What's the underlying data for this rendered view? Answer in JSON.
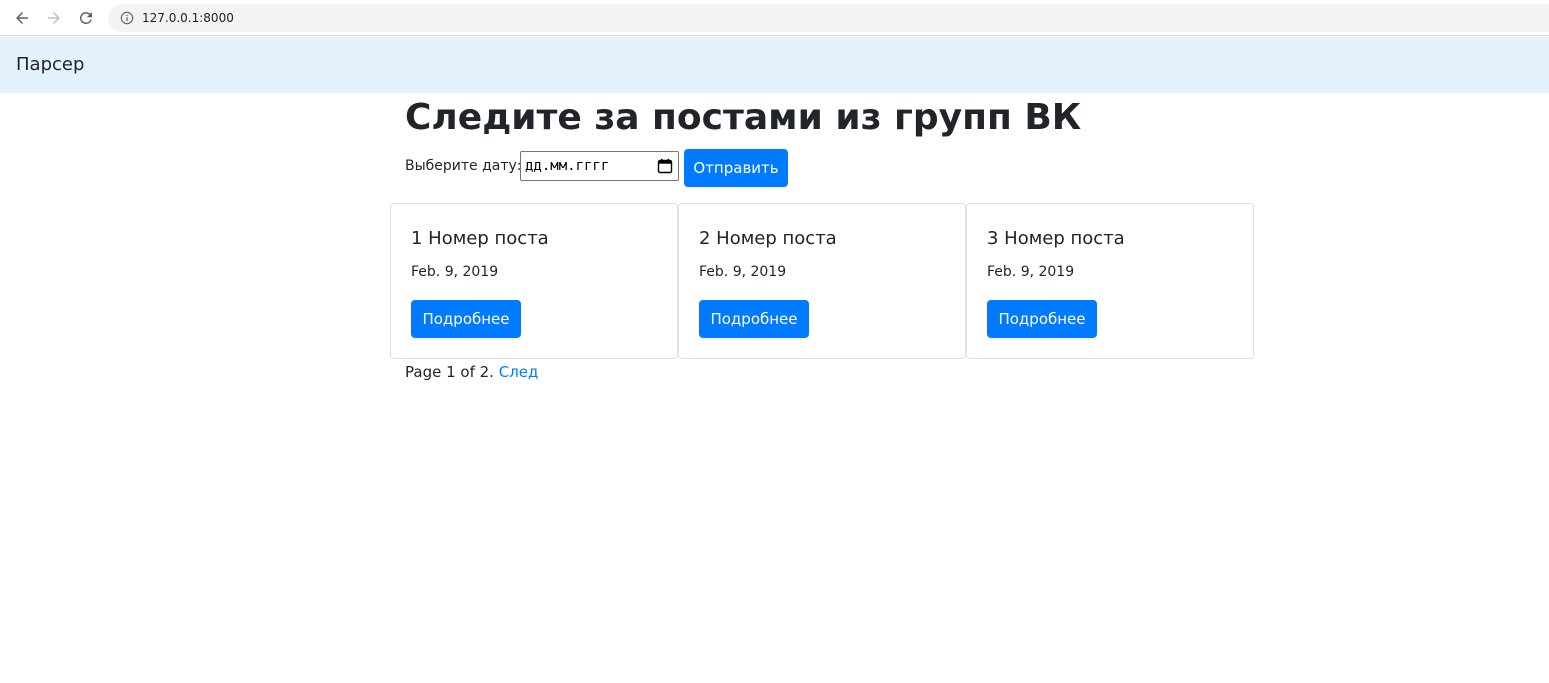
{
  "browser": {
    "url": "127.0.0.1:8000",
    "icons": [
      "back-arrow-icon",
      "forward-arrow-icon",
      "reload-icon",
      "info-icon"
    ]
  },
  "navbar": {
    "brand": "Парсер",
    "background": "#e3f2fd"
  },
  "main": {
    "title": "Следите за постами из групп ВК",
    "form": {
      "label": "Выберите дату:",
      "date_placeholder": "дд.мм.гггг",
      "submit_label": "Отправить",
      "calendar_icon": "calendar-icon"
    },
    "posts": [
      {
        "title": "1 Номер поста",
        "date": "Feb. 9, 2019",
        "button_label": "Подробнее"
      },
      {
        "title": "2 Номер поста",
        "date": "Feb. 9, 2019",
        "button_label": "Подробнее"
      },
      {
        "title": "3 Номер поста",
        "date": "Feb. 9, 2019",
        "button_label": "Подробнее"
      }
    ],
    "pagination": {
      "text": "Page 1 of 2.",
      "next_label": "След"
    }
  },
  "colors": {
    "primary": "#007bff",
    "text": "#212529"
  }
}
